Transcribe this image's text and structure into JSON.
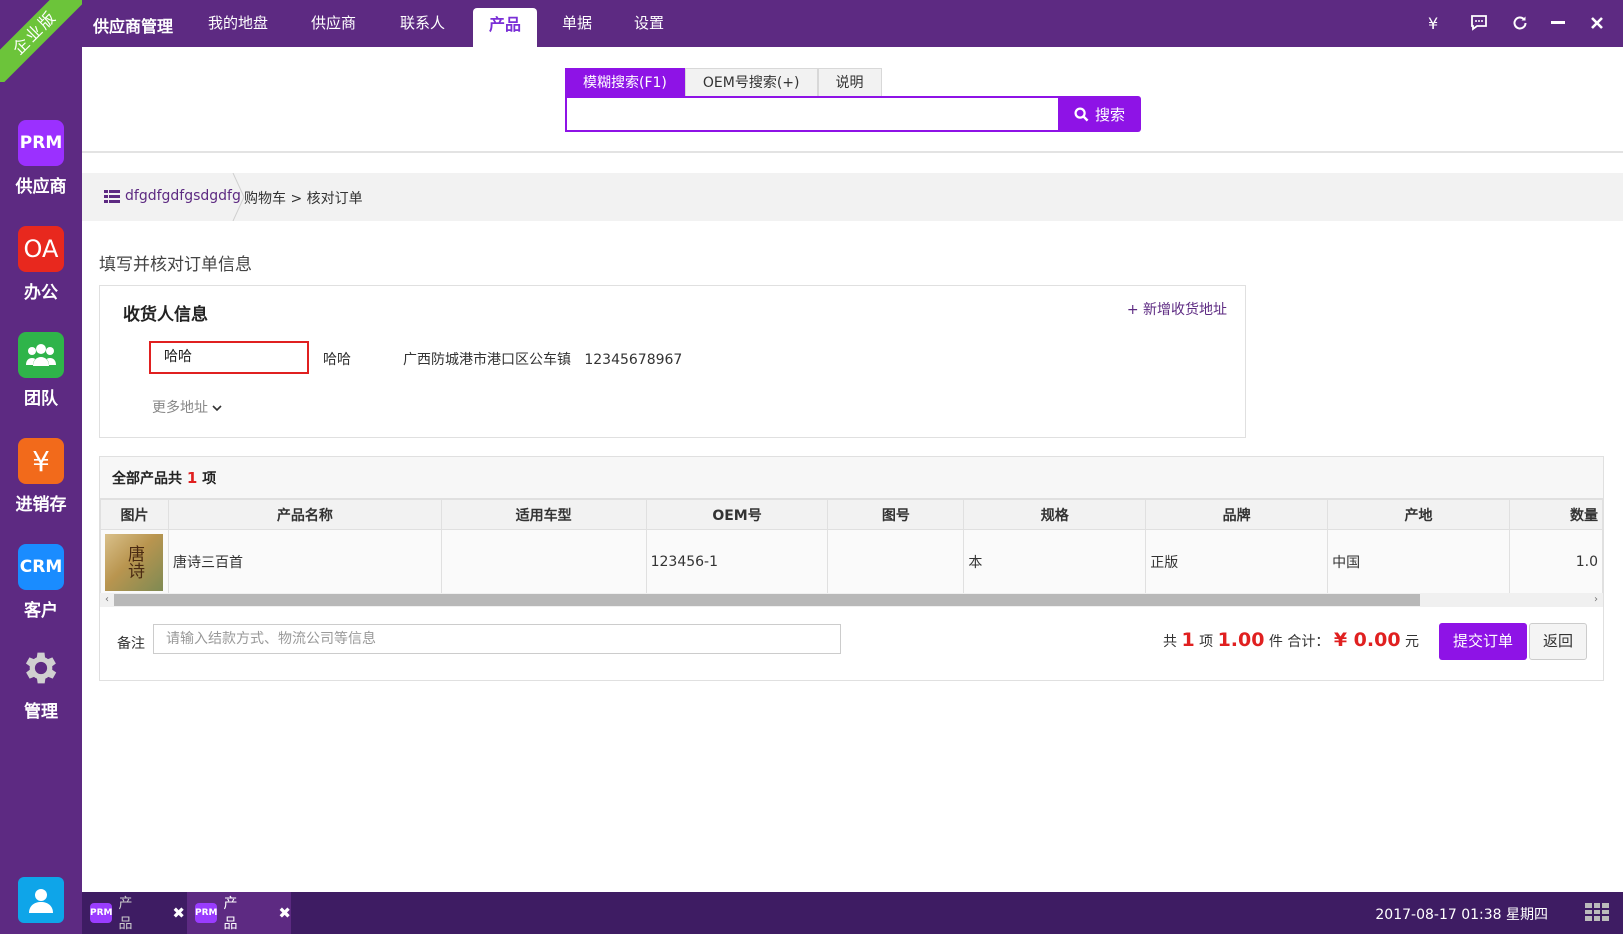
{
  "sidebar": {
    "edition_ribbon": "企业版",
    "apps": [
      {
        "icon_text": "PRM",
        "label": "供应商",
        "color": "#9b30ff"
      },
      {
        "icon_text": "OA",
        "label": "办公",
        "color": "#e8281e"
      },
      {
        "icon": "team-icon",
        "label": "团队",
        "color": "#2fb44a"
      },
      {
        "icon_text": "¥",
        "label": "进销存",
        "color": "#f26a1b"
      },
      {
        "icon_text": "CRM",
        "label": "客户",
        "color": "#1a8cff"
      },
      {
        "icon": "gear-icon",
        "label": "管理",
        "color": "#cccccc"
      }
    ],
    "user_icon": "user-icon"
  },
  "topbar": {
    "brand": "供应商管理",
    "nav": [
      "我的地盘",
      "供应商",
      "联系人",
      "产品",
      "单据",
      "设置"
    ],
    "active_nav": "产品",
    "controls": [
      "yen-icon",
      "chat-icon",
      "refresh-icon",
      "minimize-icon",
      "close-icon"
    ],
    "yen_symbol": "¥"
  },
  "search": {
    "tabs": [
      "模糊搜索(F1)",
      "OEM号搜索(+)",
      "说明"
    ],
    "active_tab": "模糊搜索(F1)",
    "value": "",
    "button": "搜索"
  },
  "breadcrumb": {
    "home": "dfgdfgdfgsdgdfg",
    "path": "购物车 > 核对订单"
  },
  "page_title": "填写并核对订单信息",
  "receiver": {
    "heading": "收货人信息",
    "add_link": "+ 新增收货地址",
    "selected_name": "哈哈",
    "name": "哈哈",
    "address": "广西防城港市港口区公车镇",
    "phone": "12345678967",
    "more": "更多地址"
  },
  "products": {
    "heading_prefix": "全部产品共",
    "count": "1",
    "heading_suffix": "项",
    "columns": [
      "图片",
      "产品名称",
      "适用车型",
      "OEM号",
      "图号",
      "规格",
      "品牌",
      "产地",
      "数量"
    ],
    "rows": [
      {
        "thumb_text": "唐诗",
        "name": "唐诗三百首",
        "car_model": "",
        "oem": "123456-1",
        "drawing_no": "",
        "spec": "本",
        "brand": "正版",
        "origin": "中国",
        "qty": "1.0"
      }
    ],
    "scroll_position": 0.92
  },
  "footer": {
    "note_label": "备注",
    "note_placeholder": "请输入结款方式、物流公司等信息",
    "sum_prefix": "共",
    "item_count": "1",
    "item_unit": "项",
    "piece_count": "1.00",
    "piece_unit": "件 合计：",
    "total": "¥ 0.00",
    "currency_unit": "元",
    "submit": "提交订单",
    "back": "返回"
  },
  "taskbar": {
    "tasks": [
      {
        "badge": "PRM",
        "label": "产品"
      },
      {
        "badge": "PRM",
        "label": "产品"
      }
    ],
    "clock": "2017-08-17 01:38 星期四"
  },
  "colors": {
    "primary": "#5d2a82",
    "accent": "#8e13e6",
    "danger": "#e02020",
    "ribbon": "#6cc43a"
  }
}
